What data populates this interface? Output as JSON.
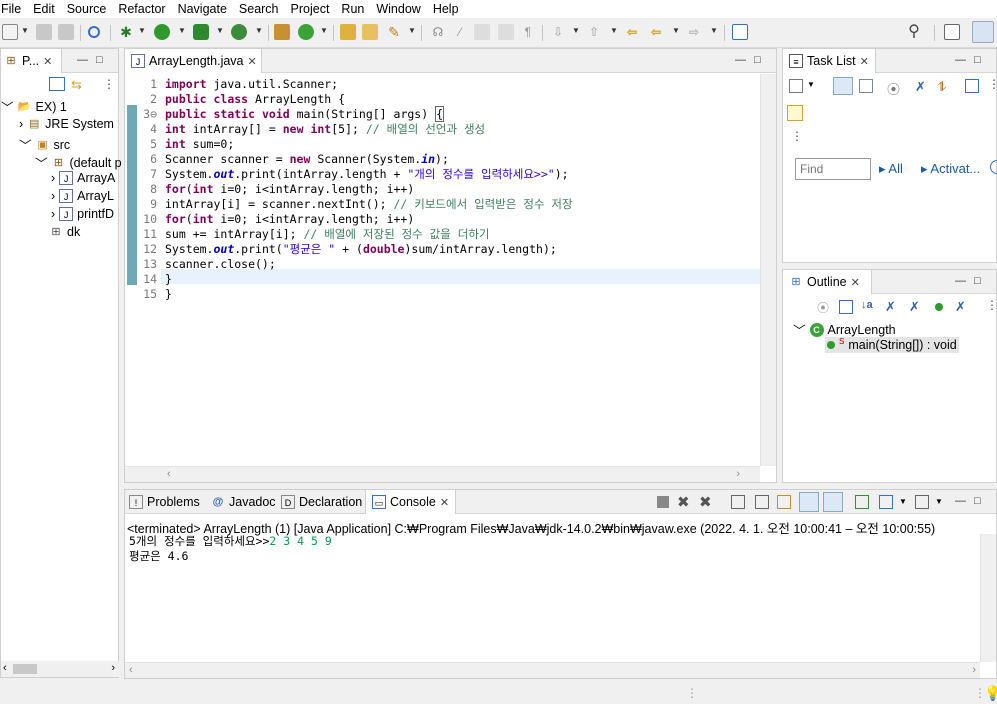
{
  "menu": [
    "File",
    "Edit",
    "Source",
    "Refactor",
    "Navigate",
    "Search",
    "Project",
    "Run",
    "Window",
    "Help"
  ],
  "explorer": {
    "tab_label": "P...",
    "items": [
      {
        "label": "EX) 1"
      },
      {
        "label": "JRE System"
      },
      {
        "label": "src"
      },
      {
        "label": "(default p"
      },
      {
        "label": "ArrayA"
      },
      {
        "label": "ArrayL"
      },
      {
        "label": "printfD"
      },
      {
        "label": "dk"
      }
    ]
  },
  "editor": {
    "tab_label": "ArrayLength.java",
    "line_numbers": [
      "1",
      "2",
      "3⊖",
      "4",
      "5",
      "6",
      "7",
      "8",
      "9",
      "10",
      "11",
      "12",
      "13",
      "14",
      "15"
    ]
  },
  "tasklist": {
    "tab_label": "Task List",
    "find_placeholder": "Find",
    "all_label": "All",
    "activate_label": "Activat..."
  },
  "outline": {
    "tab_label": "Outline",
    "class_name": "ArrayLength",
    "method_label": "main(String[]) : void"
  },
  "bottom": {
    "tabs": [
      "Problems",
      "Javadoc",
      "Declaration",
      "Console"
    ],
    "console_header": "<terminated> ArrayLength (1) [Java Application] C:₩Program Files₩Java₩jdk-14.0.2₩bin₩javaw.exe  (2022. 4. 1. 오전 10:00:41 – 오전 10:00:55)",
    "output_prompt": "5개의 정수를 입력하세요>>",
    "output_input": "2 3 4 5 9",
    "output_result": "평균은 4.6"
  }
}
